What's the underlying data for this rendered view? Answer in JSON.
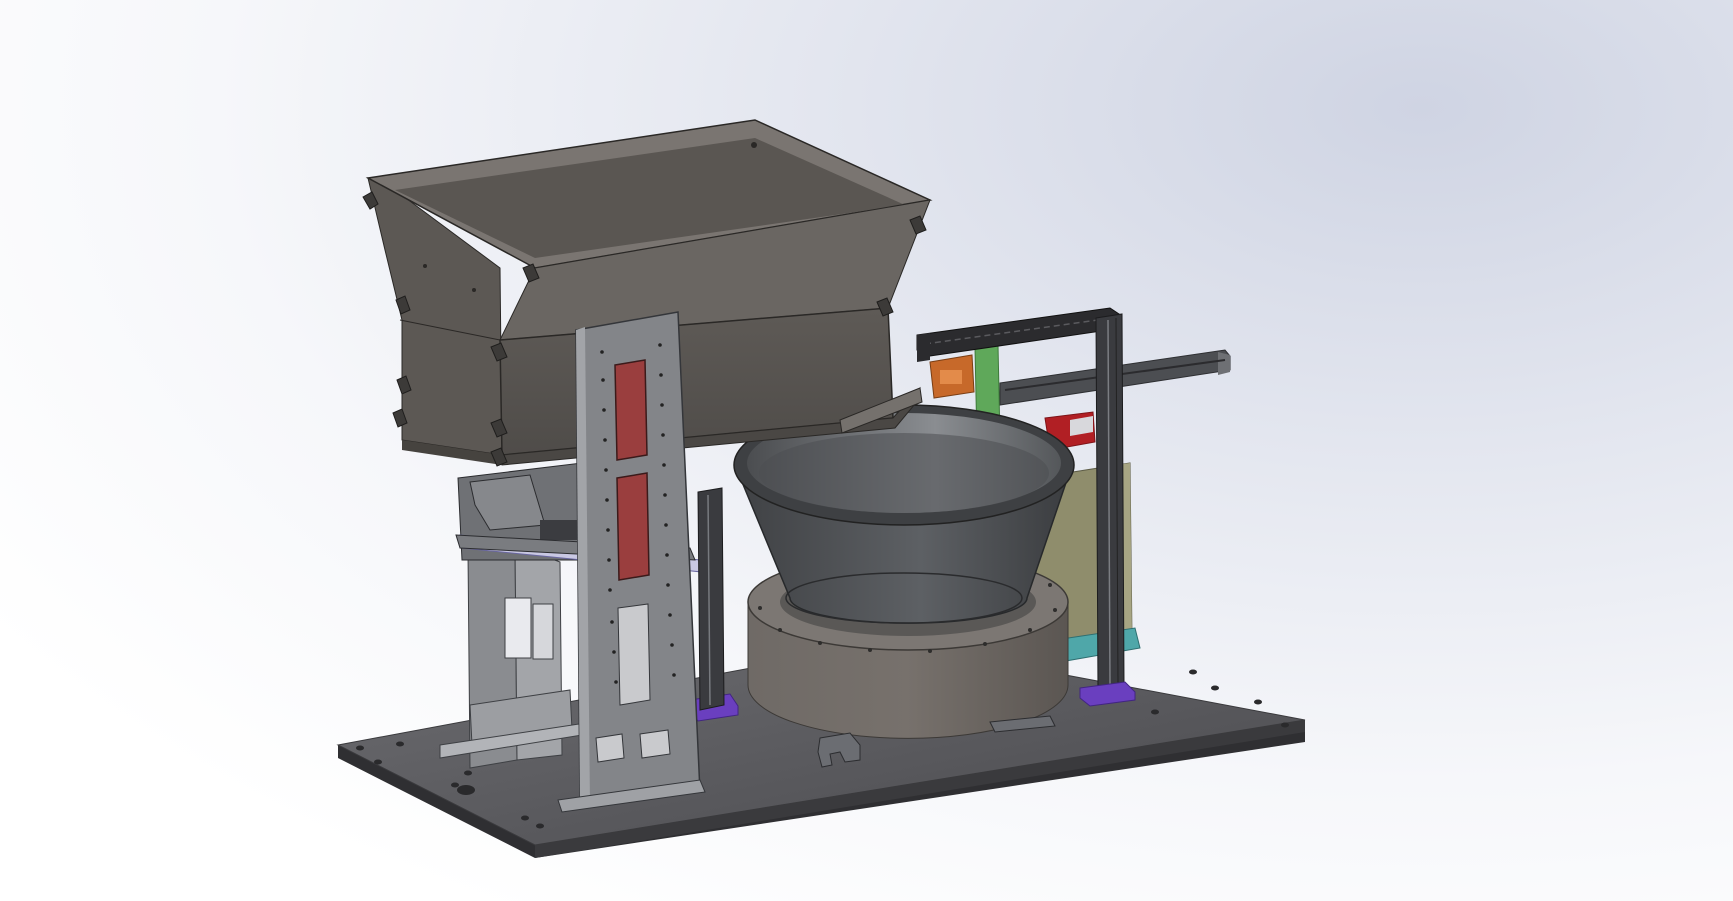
{
  "scene": {
    "kind": "cad-3d-assembly-render",
    "colors": {
      "background_light": "#ffffff",
      "background_tint": "#cfd4e3",
      "base_plate": "#5a5a5d",
      "hopper": "#5f5b57",
      "bowl": "#4a4c4f",
      "bowl_drum": "#6a6561",
      "frame_gray": "#8a8c90",
      "rail_dark": "#2b2b2e",
      "accent_red": "#b11f24",
      "accent_purple": "#6a3fbf",
      "accent_green": "#5fa85a",
      "accent_teal": "#4fa7a9",
      "accent_orange": "#c7692a",
      "window_red": "#9a3e3e",
      "back_panel": "#8f8d6c"
    }
  }
}
